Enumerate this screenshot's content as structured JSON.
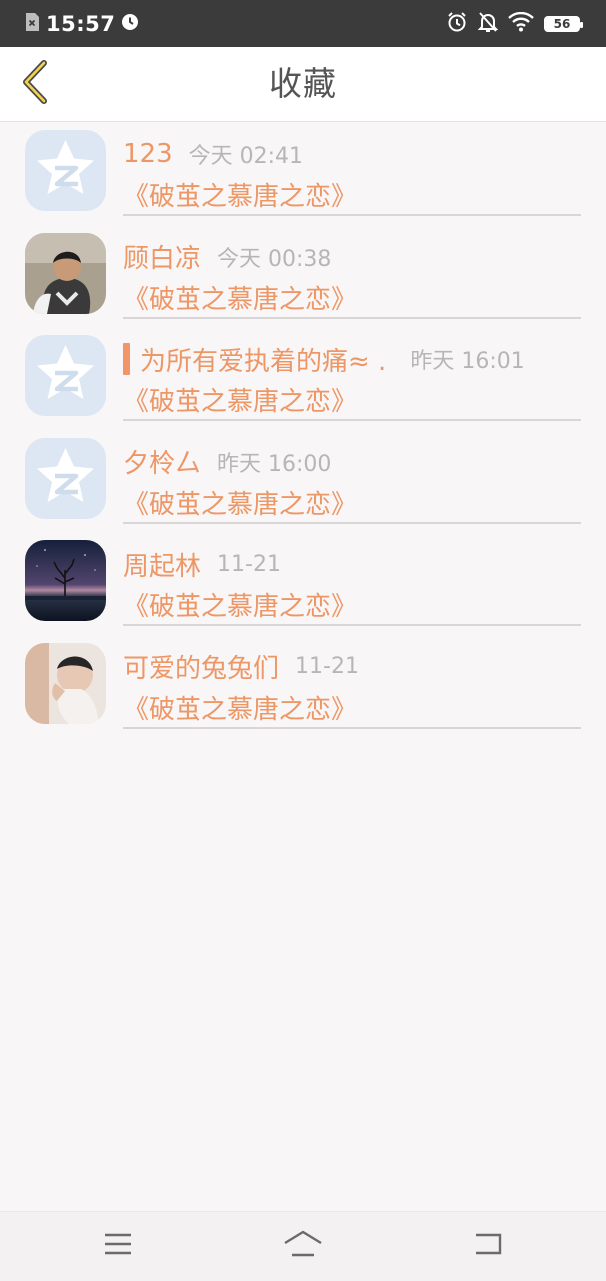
{
  "status_bar": {
    "time": "15:57",
    "battery_level": "56",
    "icons": [
      "sim-error-icon",
      "alarm-icon",
      "alarm-icon",
      "notifications-off-icon",
      "wifi-icon",
      "battery-icon"
    ]
  },
  "header": {
    "title": "收藏",
    "back_icon": "chevron-left-icon"
  },
  "favorites": [
    {
      "name": "123",
      "time": "今天 02:41",
      "content": "《破茧之慕唐之恋》",
      "avatar": "qq-default-avatar"
    },
    {
      "name": "顾白凉",
      "time": "今天 00:38",
      "content": "《破茧之慕唐之恋》",
      "avatar": "photo-avatar-child"
    },
    {
      "name": "为所有爱执着的痛≈ .",
      "time": "昨天 16:01",
      "content": "《破茧之慕唐之恋》",
      "avatar": "qq-default-avatar"
    },
    {
      "name": "夕柃厶",
      "time": "昨天 16:00",
      "content": "《破茧之慕唐之恋》",
      "avatar": "qq-default-avatar"
    },
    {
      "name": "周起林",
      "time": "11-21",
      "content": "《破茧之慕唐之恋》",
      "avatar": "photo-avatar-night-tree"
    },
    {
      "name": "可爱的兔兔们",
      "time": "11-21",
      "content": "《破茧之慕唐之恋》",
      "avatar": "photo-avatar-person"
    }
  ],
  "colors": {
    "accent": "#ee9766",
    "time_text": "#b7b5b6",
    "status_bar_bg": "#3b3b3b",
    "background": "#f8f6f7"
  },
  "nav_bar": {
    "icons": [
      "menu-icon",
      "home-icon",
      "back-icon"
    ]
  }
}
